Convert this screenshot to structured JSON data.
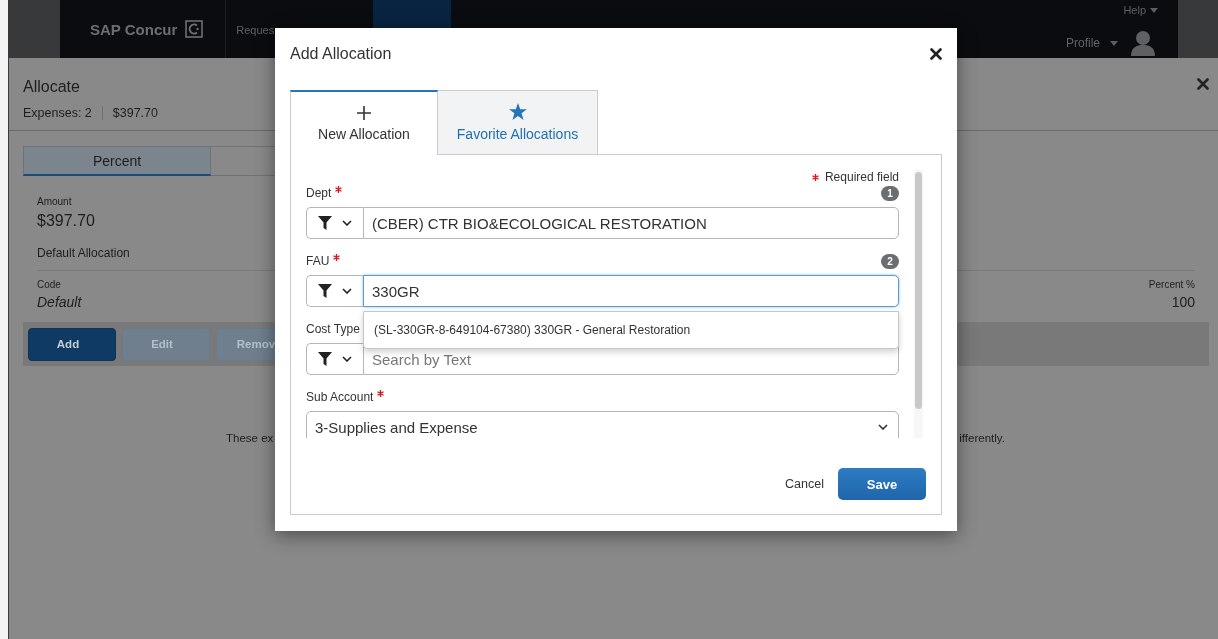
{
  "nav": {
    "logo": "SAP Concur",
    "items": [
      {
        "label": "Reques",
        "selected": false
      },
      {
        "selected": true
      }
    ],
    "help": "Help",
    "profile": "Profile"
  },
  "allocate": {
    "title": "Allocate",
    "expenses": "Expenses: 2",
    "total": "$397.70",
    "tabs": [
      {
        "label": "Percent",
        "selected": true
      },
      {
        "selected": false
      }
    ],
    "amount_label": "Amount",
    "amount": "$397.70",
    "default_allocation": "Default Allocation",
    "code_label": "Code",
    "code_value": "Default",
    "percent_label": "Percent %",
    "percent_value": "100",
    "buttons": [
      {
        "label": "Add",
        "disabled": false
      },
      {
        "label": "Edit",
        "disabled": true
      },
      {
        "label": "Remov",
        "disabled": true
      }
    ],
    "notice_left": "These ex",
    "notice_right": "ifferently."
  },
  "modal": {
    "title": "Add Allocation",
    "tabs": [
      {
        "label": "New Allocation",
        "selected": true
      },
      {
        "label": "Favorite Allocations",
        "selected": false
      }
    ],
    "required_note": "Required field",
    "fields": [
      {
        "label": "Dept",
        "required": true,
        "step": "1",
        "kind": "search",
        "value": "(CBER) CTR BIO&ECOLOGICAL RESTORATION",
        "focused": false
      },
      {
        "label": "FAU",
        "required": true,
        "step": "2",
        "kind": "search",
        "value": "330GR",
        "focused": true,
        "suggestions": [
          "(SL-330GR-8-649104-67380) 330GR - General Restoration"
        ]
      },
      {
        "label": "Cost Type",
        "required": false,
        "kind": "search",
        "placeholder": "Search by Text",
        "focused": false
      },
      {
        "label": "Sub Account",
        "required": true,
        "kind": "select",
        "value": "3-Supplies and Expense"
      }
    ],
    "cancel": "Cancel",
    "save": "Save"
  }
}
